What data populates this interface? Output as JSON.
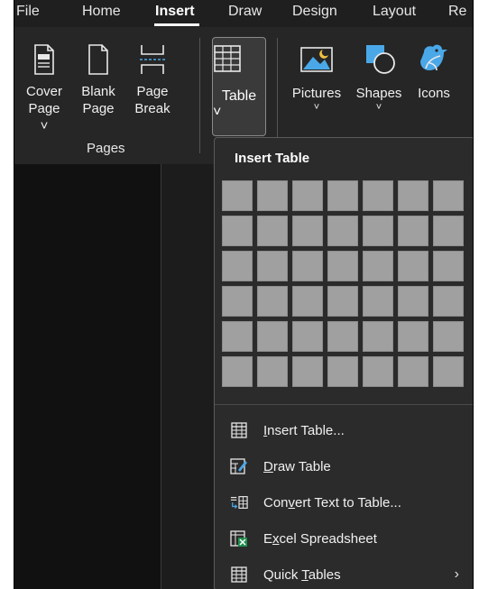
{
  "tabs": [
    {
      "label": "File"
    },
    {
      "label": "Home"
    },
    {
      "label": "Insert"
    },
    {
      "label": "Draw"
    },
    {
      "label": "Design"
    },
    {
      "label": "Layout"
    },
    {
      "label": "Re"
    }
  ],
  "active_tab": "Insert",
  "ribbon": {
    "cover_page": {
      "line1": "Cover",
      "line2": "Page ˅"
    },
    "blank_page": {
      "line1": "Blank",
      "line2": "Page"
    },
    "page_break": {
      "line1": "Page",
      "line2": "Break"
    },
    "pages_group_label": "Pages",
    "table": {
      "label": "Table",
      "chevron": "˅"
    },
    "pictures": {
      "label": "Pictures",
      "chevron": "˅"
    },
    "shapes": {
      "label": "Shapes",
      "chevron": "˅"
    },
    "icons": {
      "label": "Icons"
    }
  },
  "dropdown": {
    "title": "Insert Table",
    "grid": {
      "rows": 6,
      "cols": 7
    },
    "items": [
      {
        "label_pre": "",
        "label_ul": "I",
        "label_post": "nsert Table...",
        "icon": "insert-table-icon"
      },
      {
        "label_pre": "",
        "label_ul": "D",
        "label_post": "raw Table",
        "icon": "draw-table-icon"
      },
      {
        "label_pre": "Con",
        "label_ul": "v",
        "label_post": "ert Text to Table...",
        "icon": "convert-text-icon"
      },
      {
        "label_pre": "E",
        "label_ul": "x",
        "label_post": "cel Spreadsheet",
        "icon": "excel-spreadsheet-icon"
      },
      {
        "label_pre": "Quick ",
        "label_ul": "T",
        "label_post": "ables",
        "icon": "quick-tables-icon",
        "submenu": "›"
      }
    ]
  },
  "colors": {
    "background": "#1f1f1f",
    "ribbon": "#262626",
    "grid_cell": "#a0a0a0",
    "accent_blue": "#4aa8e8"
  }
}
